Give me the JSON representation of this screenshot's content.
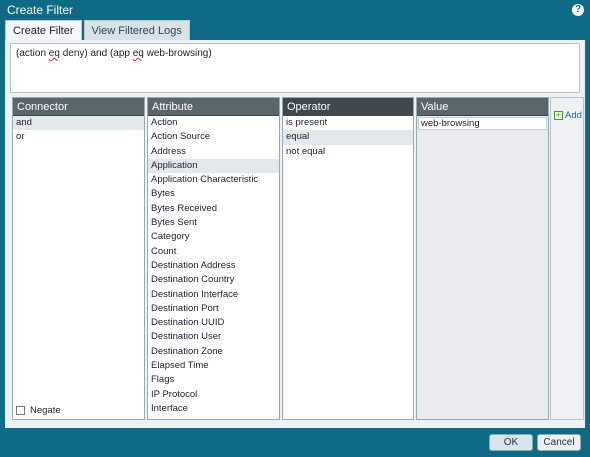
{
  "window": {
    "title": "Create Filter"
  },
  "tabs": [
    {
      "label": "Create Filter",
      "active": true
    },
    {
      "label": "View Filtered Logs",
      "active": false
    }
  ],
  "expression": {
    "parts": [
      "(action ",
      "eq",
      " deny) and (app ",
      "eq",
      " web-browsing)"
    ]
  },
  "columns": {
    "connector": {
      "header": "Connector",
      "items": [
        "and",
        "or"
      ],
      "selected": "and"
    },
    "attribute": {
      "header": "Attribute",
      "items": [
        "Action",
        "Action Source",
        "Address",
        "Application",
        "Application Characteristic",
        "Bytes",
        "Bytes Received",
        "Bytes Sent",
        "Category",
        "Count",
        "Destination Address",
        "Destination Country",
        "Destination Interface",
        "Destination Port",
        "Destination UUID",
        "Destination User",
        "Destination Zone",
        "Elapsed Time",
        "Flags",
        "IP Protocol",
        "Interface"
      ],
      "selected": "Application"
    },
    "operator": {
      "header": "Operator",
      "items": [
        "is present",
        "equal",
        "not equal"
      ],
      "selected": "equal"
    },
    "value": {
      "header": "Value",
      "current": "web-browsing"
    }
  },
  "add": {
    "label": "Add"
  },
  "negate": {
    "label": "Negate",
    "checked": false
  },
  "footer": {
    "ok_label": "OK",
    "cancel_label": "Cancel"
  },
  "colors": {
    "accent": "#0e6a85",
    "header": "#5b666c",
    "selected_row": "#e3e8eb"
  }
}
